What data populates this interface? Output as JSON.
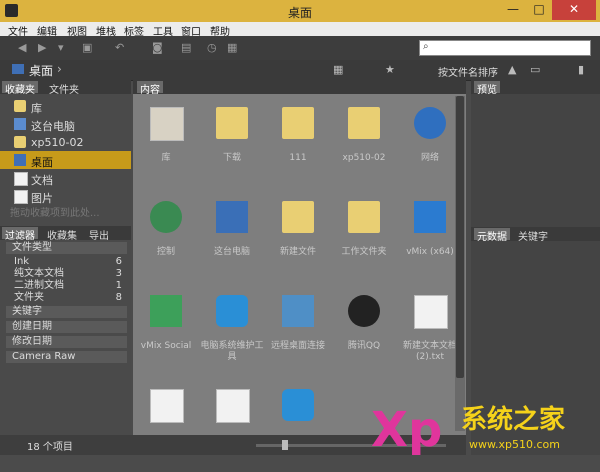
{
  "window": {
    "title": "桌面",
    "controls": {
      "minimize": "—",
      "maximize": "□",
      "close": "✕"
    }
  },
  "menu": [
    "文件",
    "编辑",
    "视图",
    "堆栈",
    "标签",
    "工具",
    "窗口",
    "帮助"
  ],
  "search": {
    "placeholder": ""
  },
  "path": {
    "crumb": "桌面",
    "chevron": "›"
  },
  "sort": {
    "label": "按文件名排序"
  },
  "left_tabs": {
    "favorites": "收藏夹",
    "folders": "文件夹"
  },
  "favorites": [
    {
      "label": "库",
      "icon": "folder-icon"
    },
    {
      "label": "这台电脑",
      "icon": "computer-icon"
    },
    {
      "label": "xp510-02",
      "icon": "user-folder-icon"
    },
    {
      "label": "桌面",
      "icon": "desktop-icon",
      "selected": true
    },
    {
      "label": "文档",
      "icon": "documents-icon"
    },
    {
      "label": "图片",
      "icon": "pictures-icon"
    }
  ],
  "favorites_hint": "拖动收藏项到此处...",
  "filter_tabs": {
    "filter": "过滤器",
    "collections": "收藏集",
    "export": "导出"
  },
  "filter": {
    "file_type_header": "文件类型",
    "rows": [
      {
        "label": "Ink",
        "count": "6"
      },
      {
        "label": "纯文本文档",
        "count": "3"
      },
      {
        "label": "二进制文档",
        "count": "1"
      },
      {
        "label": "文件夹",
        "count": "8"
      }
    ],
    "sections": [
      "关键字",
      "创建日期",
      "修改日期",
      "Camera Raw"
    ]
  },
  "content_tab": "内容",
  "items": [
    {
      "label": "库",
      "icon": "library-icon"
    },
    {
      "label": "下载",
      "icon": "folder-icon"
    },
    {
      "label": "111",
      "icon": "folder-icon"
    },
    {
      "label": "xp510-02",
      "icon": "folder-icon"
    },
    {
      "label": "网络",
      "icon": "network-icon"
    },
    {
      "label": "控制",
      "icon": "control-panel-icon"
    },
    {
      "label": "这台电脑",
      "icon": "computer-icon"
    },
    {
      "label": "新建文件",
      "icon": "folder-icon"
    },
    {
      "label": "工作文件夹",
      "icon": "shortcut-icon"
    },
    {
      "label": "vMix (x64)",
      "icon": "app-icon"
    },
    {
      "label": "vMix Social",
      "icon": "app-icon"
    },
    {
      "label": "电脑系统维护工具",
      "icon": "app-icon"
    },
    {
      "label": "远程桌面连接",
      "icon": "monitor-icon"
    },
    {
      "label": "腾讯QQ",
      "icon": "qq-icon"
    },
    {
      "label": "新建文本文档 (2).txt",
      "icon": "document-icon"
    },
    {
      "label": "",
      "icon": "document-icon"
    },
    {
      "label": "",
      "icon": "document-icon"
    },
    {
      "label": "",
      "icon": "app-icon"
    }
  ],
  "right_tabs": {
    "preview": "预览",
    "metadata": "元数据",
    "keywords": "关键字"
  },
  "status": {
    "count_text": "18 个项目"
  },
  "watermark": {
    "text": "XP系统之家",
    "url": "www.xp510.com"
  }
}
